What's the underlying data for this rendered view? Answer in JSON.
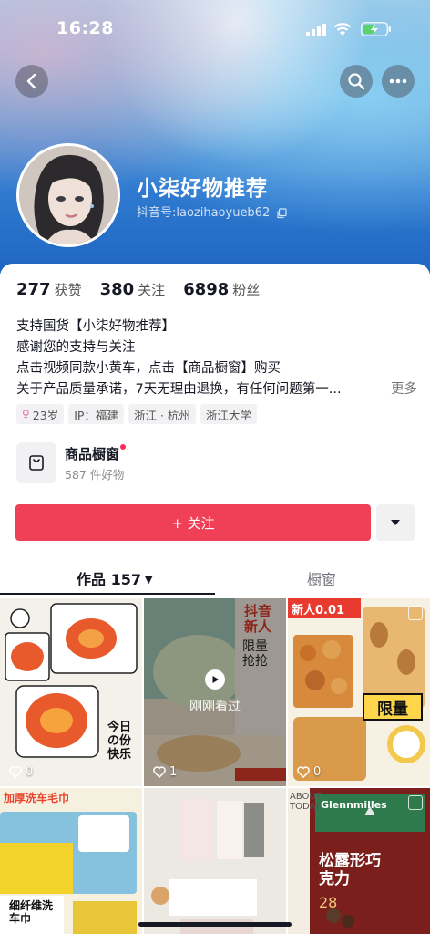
{
  "status_bar": {
    "time": "16:28"
  },
  "header": {
    "name": "小柒好物推荐",
    "douyin_id": "抖音号:laozihaoyueb62"
  },
  "stats": [
    {
      "num": "277",
      "label": "获赞"
    },
    {
      "num": "380",
      "label": "关注"
    },
    {
      "num": "6898",
      "label": "粉丝"
    }
  ],
  "bio": {
    "lines": [
      "支持国货【小柒好物推荐】",
      "感谢您的支持与关注",
      "点击视频同款小黄车，点击【商品橱窗】购买",
      "关于产品质量承诺，7天无理由退换，有任何问题第一..."
    ],
    "more": "更多"
  },
  "tags": {
    "age": "23岁",
    "ip": "IP：福建",
    "location": "浙江 · 杭州",
    "school": "浙江大学"
  },
  "shop": {
    "title": "商品橱窗",
    "subtitle": "587 件好物"
  },
  "actions": {
    "follow": "+ 关注"
  },
  "tabs": {
    "works": "作品 157",
    "shop": "橱窗"
  },
  "grid": {
    "just_watched": "刚刚看过",
    "items": [
      {
        "likes": "0"
      },
      {
        "likes": "1"
      },
      {
        "likes": "0"
      }
    ],
    "cell_texts": {
      "c1_sticker": "今日の份快乐",
      "c2_title": "抖音新人",
      "c2_sub": "限量抢抢",
      "c3_top": "新人0.01",
      "c3_badge": "限量",
      "c4_title": "加厚洗车毛巾",
      "c4_sub": "细纤维洗车巾",
      "c5_side": "ABOUT TODAY",
      "c6_brand": "Glennmilles",
      "c6_title": "松露形巧克力",
      "c6_price": "28"
    }
  },
  "colors": {
    "accent": "#ef4057",
    "hero_bottom": "#1f66c2"
  }
}
